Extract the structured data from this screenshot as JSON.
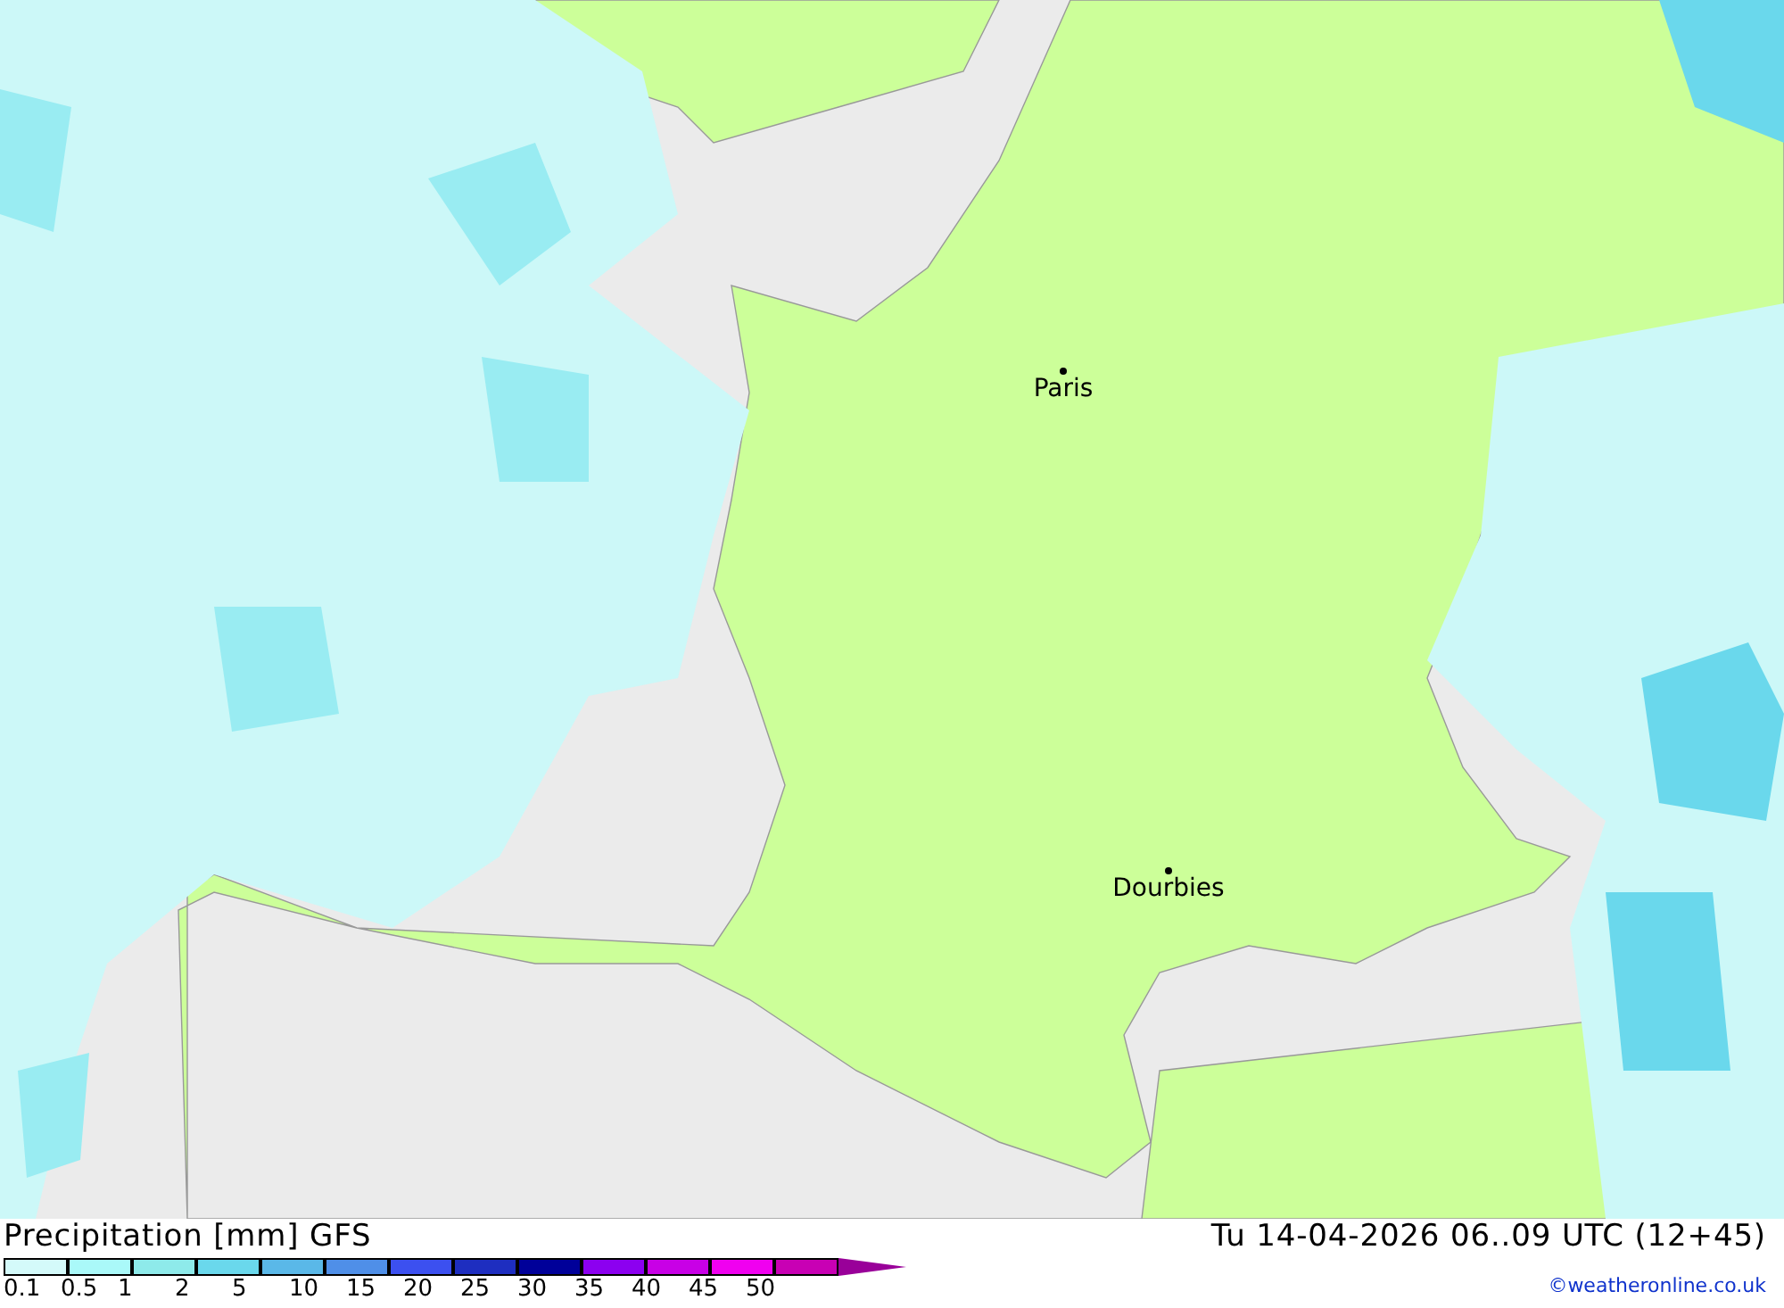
{
  "map": {
    "cities": [
      {
        "name": "Paris"
      },
      {
        "name": "Dourbies"
      }
    ]
  },
  "title": "Precipitation [mm] GFS",
  "valid_time": "Tu 14-04-2026 06..09 UTC (12+45)",
  "legend": {
    "items": [
      {
        "color": "#d4fafa"
      },
      {
        "color": "#aaf9f9"
      },
      {
        "color": "#8eeaea"
      },
      {
        "color": "#6ad8ec"
      },
      {
        "color": "#5ab8e8"
      },
      {
        "color": "#4f8fe8"
      },
      {
        "color": "#3c50f0"
      },
      {
        "color": "#1e2ec0"
      },
      {
        "color": "#000099"
      },
      {
        "color": "#8c00f0"
      },
      {
        "color": "#c800e6"
      },
      {
        "color": "#f000f0"
      },
      {
        "color": "#c800b4"
      }
    ],
    "labels": [
      "0.1",
      "0.5",
      "1",
      "2",
      "5",
      "10",
      "15",
      "20",
      "25",
      "30",
      "35",
      "40",
      "45",
      "50"
    ]
  },
  "credit": "©weatheronline.co.uk"
}
